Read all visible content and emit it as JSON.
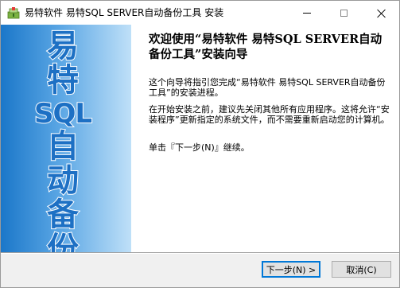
{
  "window": {
    "title": "易特软件 易特SQL SERVER自动备份工具 安装",
    "icon": "installer-icon"
  },
  "banner": {
    "lines": [
      "易",
      "特",
      "SQL",
      "自",
      "动",
      "备",
      "份"
    ],
    "colors": {
      "text": "#1d70c4",
      "outline": "#ffffff",
      "gradient_start": "#1b77c9",
      "gradient_end": "#bfe0f8"
    }
  },
  "main": {
    "heading": "欢迎使用“易特软件 易特SQL SERVER自动备份工具”安装向导",
    "paragraph1": "这个向导将指引您完成“易特软件 易特SQL SERVER自动备份工具”的安装进程。",
    "paragraph2": "在开始安装之前，建议先关闭其他所有应用程序。这将允许“安装程序”更新指定的系统文件，而不需要重新启动您的计算机。",
    "paragraph3": "单击『下一步(N)』继续。"
  },
  "buttons": {
    "next": "下一步(N) >",
    "cancel": "取消(C)"
  }
}
